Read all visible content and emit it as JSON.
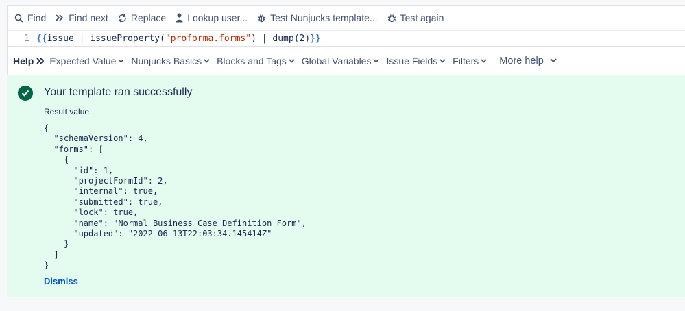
{
  "toolbar": {
    "find": "Find",
    "find_next": "Find next",
    "replace": "Replace",
    "lookup_user": "Lookup user...",
    "test_template": "Test Nunjucks template...",
    "test_again": "Test again"
  },
  "editor": {
    "line_number": "1",
    "code_open": "{{",
    "code_mid1": "issue | issueProperty(",
    "code_string": "\"proforma.forms\"",
    "code_mid2": ") | dump(2)",
    "code_close": "}}"
  },
  "helpbar": {
    "label": "Help",
    "items": [
      "Expected Value",
      "Nunjucks Basics",
      "Blocks and Tags",
      "Global Variables",
      "Issue Fields",
      "Filters"
    ],
    "more": "More help"
  },
  "result": {
    "title": "Your template ran successfully",
    "subtitle": "Result value",
    "value": "{\n  \"schemaVersion\": 4,\n  \"forms\": [\n    {\n      \"id\": 1,\n      \"projectFormId\": 2,\n      \"internal\": true,\n      \"submitted\": true,\n      \"lock\": true,\n      \"name\": \"Normal Business Case Definition Form\",\n      \"updated\": \"2022-06-13T22:03:34.145414Z\"\n    }\n  ]\n}",
    "dismiss": "Dismiss"
  },
  "colors": {
    "success_bg": "#e3fcef",
    "success_icon": "#006644",
    "link": "#0052cc"
  }
}
